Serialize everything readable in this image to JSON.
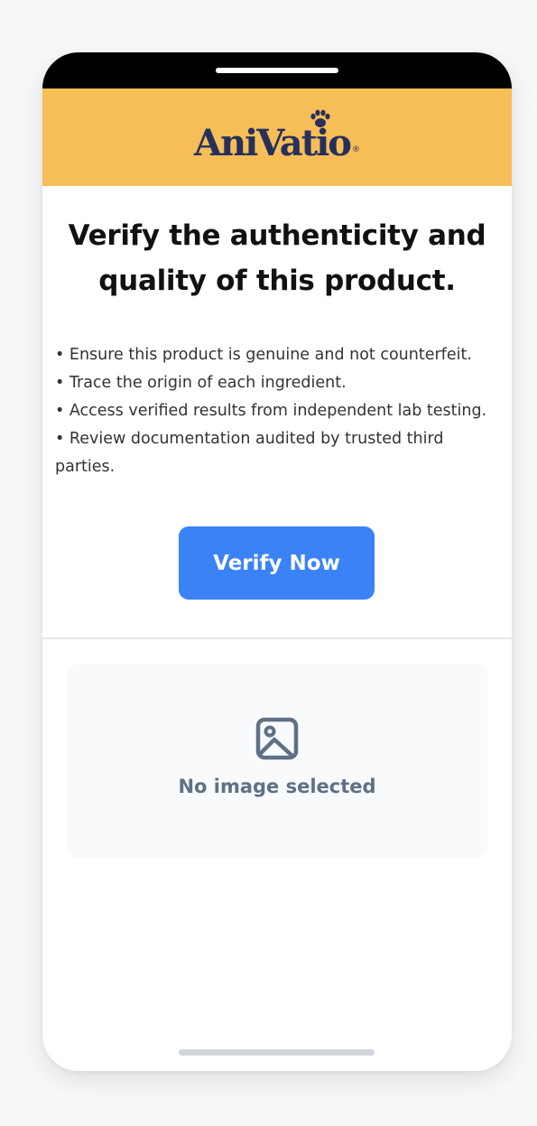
{
  "brand": {
    "name": "AniVatio",
    "registered_mark": "®",
    "header_color": "#f7bd57",
    "text_color": "#25305c"
  },
  "hero": {
    "headline": "Verify the authenticity and quality of this product.",
    "benefits": [
      "• Ensure this product is genuine and not counterfeit.",
      "• Trace the origin of each ingredient.",
      "• Access verified results from independent lab testing.",
      "• Review documentation audited by trusted third parties."
    ],
    "button_label": "Verify Now",
    "button_color": "#3b82f6"
  },
  "image_preview": {
    "empty_label": "No image selected",
    "icon": "image-icon"
  }
}
